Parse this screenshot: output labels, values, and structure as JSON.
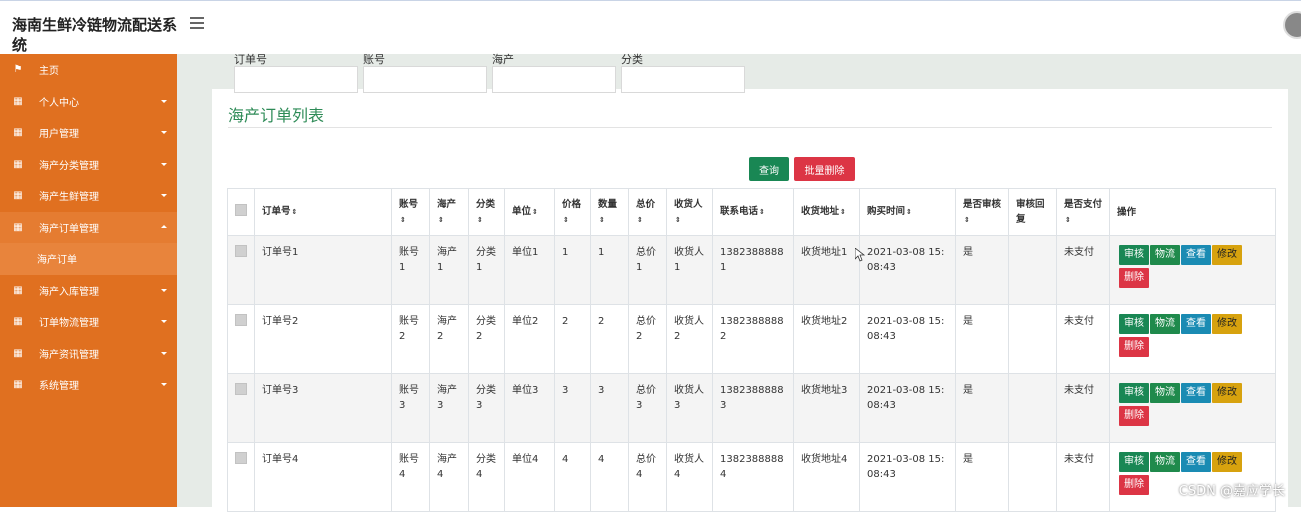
{
  "header": {
    "title": "海南生鲜冷链物流配送系统"
  },
  "sidebar": {
    "items": [
      {
        "label": "主页",
        "icon": "flag-icon"
      },
      {
        "label": "个人中心",
        "icon": "grid-icon"
      },
      {
        "label": "用户管理",
        "icon": "grid-icon"
      },
      {
        "label": "海产分类管理",
        "icon": "grid-icon"
      },
      {
        "label": "海产生鲜管理",
        "icon": "grid-icon"
      },
      {
        "label": "海产订单管理",
        "icon": "grid-icon",
        "open": true,
        "sub": "海产订单"
      },
      {
        "label": "海产入库管理",
        "icon": "grid-icon"
      },
      {
        "label": "订单物流管理",
        "icon": "grid-icon"
      },
      {
        "label": "海产资讯管理",
        "icon": "grid-icon"
      },
      {
        "label": "系统管理",
        "icon": "grid-icon"
      }
    ]
  },
  "panel": {
    "title": "海产订单列表",
    "filters": [
      {
        "label": "订单号",
        "value": ""
      },
      {
        "label": "账号",
        "value": ""
      },
      {
        "label": "海产",
        "value": ""
      },
      {
        "label": "分类",
        "value": ""
      }
    ],
    "search_label": "查询",
    "batch_delete_label": "批量删除"
  },
  "table": {
    "headers": [
      "订单号",
      "账号",
      "海产",
      "分类",
      "单位",
      "价格",
      "数量",
      "总价",
      "收货人",
      "联系电话",
      "收货地址",
      "购买时间",
      "是否审核",
      "审核回复",
      "是否支付",
      "操作"
    ],
    "sortable": [
      true,
      true,
      true,
      true,
      true,
      true,
      true,
      true,
      true,
      true,
      true,
      true,
      true,
      false,
      true,
      false
    ],
    "rows": [
      [
        "订单号1",
        "账号1",
        "海产1",
        "分类1",
        "单位1",
        "1",
        "1",
        "总价1",
        "收货人1",
        "13823888881",
        "收货地址1",
        "2021-03-08 15:08:43",
        "是",
        "",
        "未支付"
      ],
      [
        "订单号2",
        "账号2",
        "海产2",
        "分类2",
        "单位2",
        "2",
        "2",
        "总价2",
        "收货人2",
        "13823888882",
        "收货地址2",
        "2021-03-08 15:08:43",
        "是",
        "",
        "未支付"
      ],
      [
        "订单号3",
        "账号3",
        "海产3",
        "分类3",
        "单位3",
        "3",
        "3",
        "总价3",
        "收货人3",
        "13823888883",
        "收货地址3",
        "2021-03-08 15:08:43",
        "是",
        "",
        "未支付"
      ],
      [
        "订单号4",
        "账号4",
        "海产4",
        "分类4",
        "单位4",
        "4",
        "4",
        "总价4",
        "收货人4",
        "13823888884",
        "收货地址4",
        "2021-03-08 15:08:43",
        "是",
        "",
        "未支付"
      ]
    ],
    "actions": [
      "审核",
      "物流",
      "查看",
      "修改",
      "删除"
    ]
  },
  "watermark": "CSDN @嘉应学长",
  "colors": {
    "sidebar": "#e07020",
    "title": "#2e8b57",
    "search": "#198754",
    "danger": "#dc3545",
    "info": "#1a8bb3",
    "warning": "#d7a20e"
  }
}
